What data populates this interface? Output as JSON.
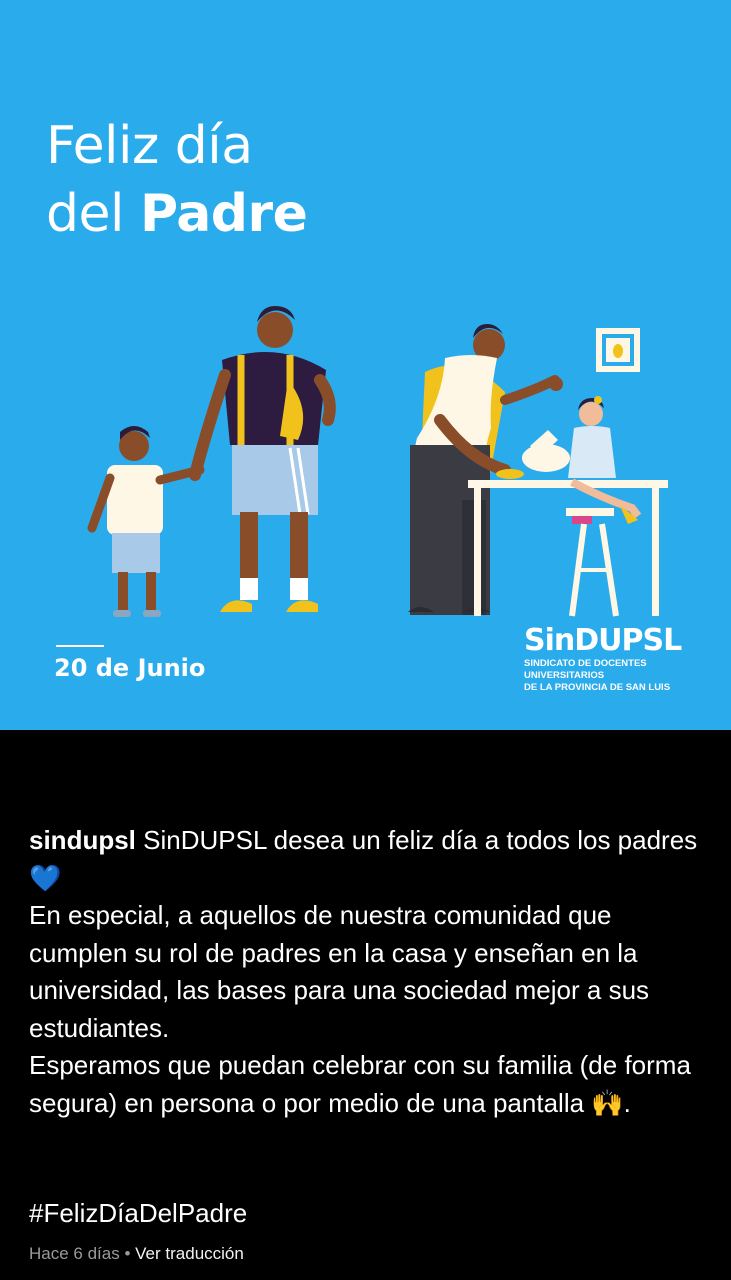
{
  "post_image": {
    "title_line1": "Feliz día",
    "title_line2_regular": "del",
    "title_line2_bold": "Padre",
    "date": "20 de Junio",
    "logo_name": "SinDUPSL",
    "logo_sub_line1": "SINDICATO DE DOCENTES UNIVERSITARIOS",
    "logo_sub_line2": "DE LA PROVINCIA DE SAN LUIS",
    "background_color": "#2aabeb"
  },
  "actions": {
    "like_icon": "heart-icon",
    "comment_icon": "comment-icon",
    "share_icon": "send-icon",
    "save_icon": "bookmark-icon"
  },
  "caption": {
    "username": "sindupsl",
    "line1": "SinDUPSL desea un feliz día a todos los padres 💙",
    "line2": "En especial, a aquellos de nuestra comunidad que cumplen su rol de padres en la casa y enseñan en la universidad, las bases para una sociedad mejor a sus estudiantes.",
    "line3": "Esperamos que puedan celebrar con su familia (de forma segura) en persona o por medio de una pantalla 🙌.",
    "hashtag": "#FelizDíaDelPadre"
  },
  "meta": {
    "time": "Hace 6 días",
    "separator": "•",
    "translate": "Ver traducción"
  }
}
